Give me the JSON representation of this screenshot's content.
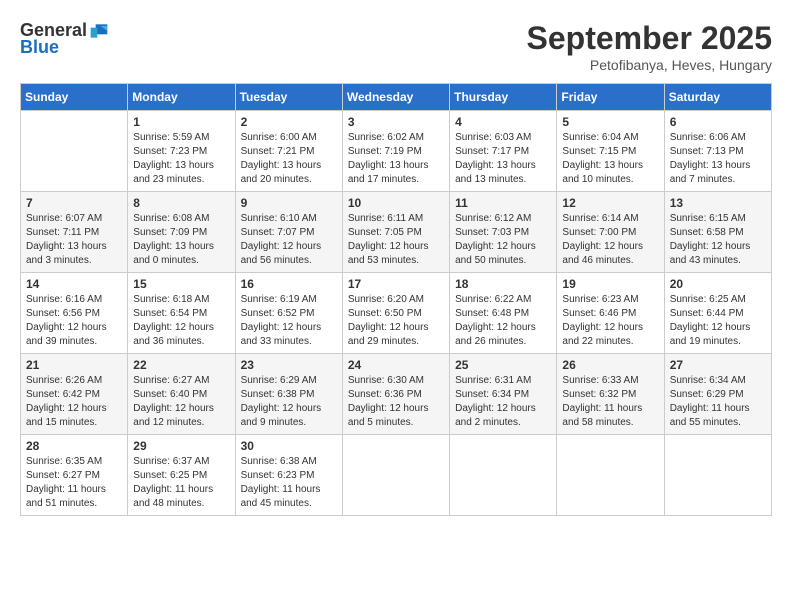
{
  "logo": {
    "general": "General",
    "blue": "Blue"
  },
  "title": "September 2025",
  "subtitle": "Petofibanya, Heves, Hungary",
  "days_header": [
    "Sunday",
    "Monday",
    "Tuesday",
    "Wednesday",
    "Thursday",
    "Friday",
    "Saturday"
  ],
  "weeks": [
    {
      "days": [
        {
          "num": "",
          "detail": ""
        },
        {
          "num": "1",
          "detail": "Sunrise: 5:59 AM\nSunset: 7:23 PM\nDaylight: 13 hours and 23 minutes."
        },
        {
          "num": "2",
          "detail": "Sunrise: 6:00 AM\nSunset: 7:21 PM\nDaylight: 13 hours and 20 minutes."
        },
        {
          "num": "3",
          "detail": "Sunrise: 6:02 AM\nSunset: 7:19 PM\nDaylight: 13 hours and 17 minutes."
        },
        {
          "num": "4",
          "detail": "Sunrise: 6:03 AM\nSunset: 7:17 PM\nDaylight: 13 hours and 13 minutes."
        },
        {
          "num": "5",
          "detail": "Sunrise: 6:04 AM\nSunset: 7:15 PM\nDaylight: 13 hours and 10 minutes."
        },
        {
          "num": "6",
          "detail": "Sunrise: 6:06 AM\nSunset: 7:13 PM\nDaylight: 13 hours and 7 minutes."
        }
      ]
    },
    {
      "days": [
        {
          "num": "7",
          "detail": "Sunrise: 6:07 AM\nSunset: 7:11 PM\nDaylight: 13 hours and 3 minutes."
        },
        {
          "num": "8",
          "detail": "Sunrise: 6:08 AM\nSunset: 7:09 PM\nDaylight: 13 hours and 0 minutes."
        },
        {
          "num": "9",
          "detail": "Sunrise: 6:10 AM\nSunset: 7:07 PM\nDaylight: 12 hours and 56 minutes."
        },
        {
          "num": "10",
          "detail": "Sunrise: 6:11 AM\nSunset: 7:05 PM\nDaylight: 12 hours and 53 minutes."
        },
        {
          "num": "11",
          "detail": "Sunrise: 6:12 AM\nSunset: 7:03 PM\nDaylight: 12 hours and 50 minutes."
        },
        {
          "num": "12",
          "detail": "Sunrise: 6:14 AM\nSunset: 7:00 PM\nDaylight: 12 hours and 46 minutes."
        },
        {
          "num": "13",
          "detail": "Sunrise: 6:15 AM\nSunset: 6:58 PM\nDaylight: 12 hours and 43 minutes."
        }
      ]
    },
    {
      "days": [
        {
          "num": "14",
          "detail": "Sunrise: 6:16 AM\nSunset: 6:56 PM\nDaylight: 12 hours and 39 minutes."
        },
        {
          "num": "15",
          "detail": "Sunrise: 6:18 AM\nSunset: 6:54 PM\nDaylight: 12 hours and 36 minutes."
        },
        {
          "num": "16",
          "detail": "Sunrise: 6:19 AM\nSunset: 6:52 PM\nDaylight: 12 hours and 33 minutes."
        },
        {
          "num": "17",
          "detail": "Sunrise: 6:20 AM\nSunset: 6:50 PM\nDaylight: 12 hours and 29 minutes."
        },
        {
          "num": "18",
          "detail": "Sunrise: 6:22 AM\nSunset: 6:48 PM\nDaylight: 12 hours and 26 minutes."
        },
        {
          "num": "19",
          "detail": "Sunrise: 6:23 AM\nSunset: 6:46 PM\nDaylight: 12 hours and 22 minutes."
        },
        {
          "num": "20",
          "detail": "Sunrise: 6:25 AM\nSunset: 6:44 PM\nDaylight: 12 hours and 19 minutes."
        }
      ]
    },
    {
      "days": [
        {
          "num": "21",
          "detail": "Sunrise: 6:26 AM\nSunset: 6:42 PM\nDaylight: 12 hours and 15 minutes."
        },
        {
          "num": "22",
          "detail": "Sunrise: 6:27 AM\nSunset: 6:40 PM\nDaylight: 12 hours and 12 minutes."
        },
        {
          "num": "23",
          "detail": "Sunrise: 6:29 AM\nSunset: 6:38 PM\nDaylight: 12 hours and 9 minutes."
        },
        {
          "num": "24",
          "detail": "Sunrise: 6:30 AM\nSunset: 6:36 PM\nDaylight: 12 hours and 5 minutes."
        },
        {
          "num": "25",
          "detail": "Sunrise: 6:31 AM\nSunset: 6:34 PM\nDaylight: 12 hours and 2 minutes."
        },
        {
          "num": "26",
          "detail": "Sunrise: 6:33 AM\nSunset: 6:32 PM\nDaylight: 11 hours and 58 minutes."
        },
        {
          "num": "27",
          "detail": "Sunrise: 6:34 AM\nSunset: 6:29 PM\nDaylight: 11 hours and 55 minutes."
        }
      ]
    },
    {
      "days": [
        {
          "num": "28",
          "detail": "Sunrise: 6:35 AM\nSunset: 6:27 PM\nDaylight: 11 hours and 51 minutes."
        },
        {
          "num": "29",
          "detail": "Sunrise: 6:37 AM\nSunset: 6:25 PM\nDaylight: 11 hours and 48 minutes."
        },
        {
          "num": "30",
          "detail": "Sunrise: 6:38 AM\nSunset: 6:23 PM\nDaylight: 11 hours and 45 minutes."
        },
        {
          "num": "",
          "detail": ""
        },
        {
          "num": "",
          "detail": ""
        },
        {
          "num": "",
          "detail": ""
        },
        {
          "num": "",
          "detail": ""
        }
      ]
    }
  ]
}
